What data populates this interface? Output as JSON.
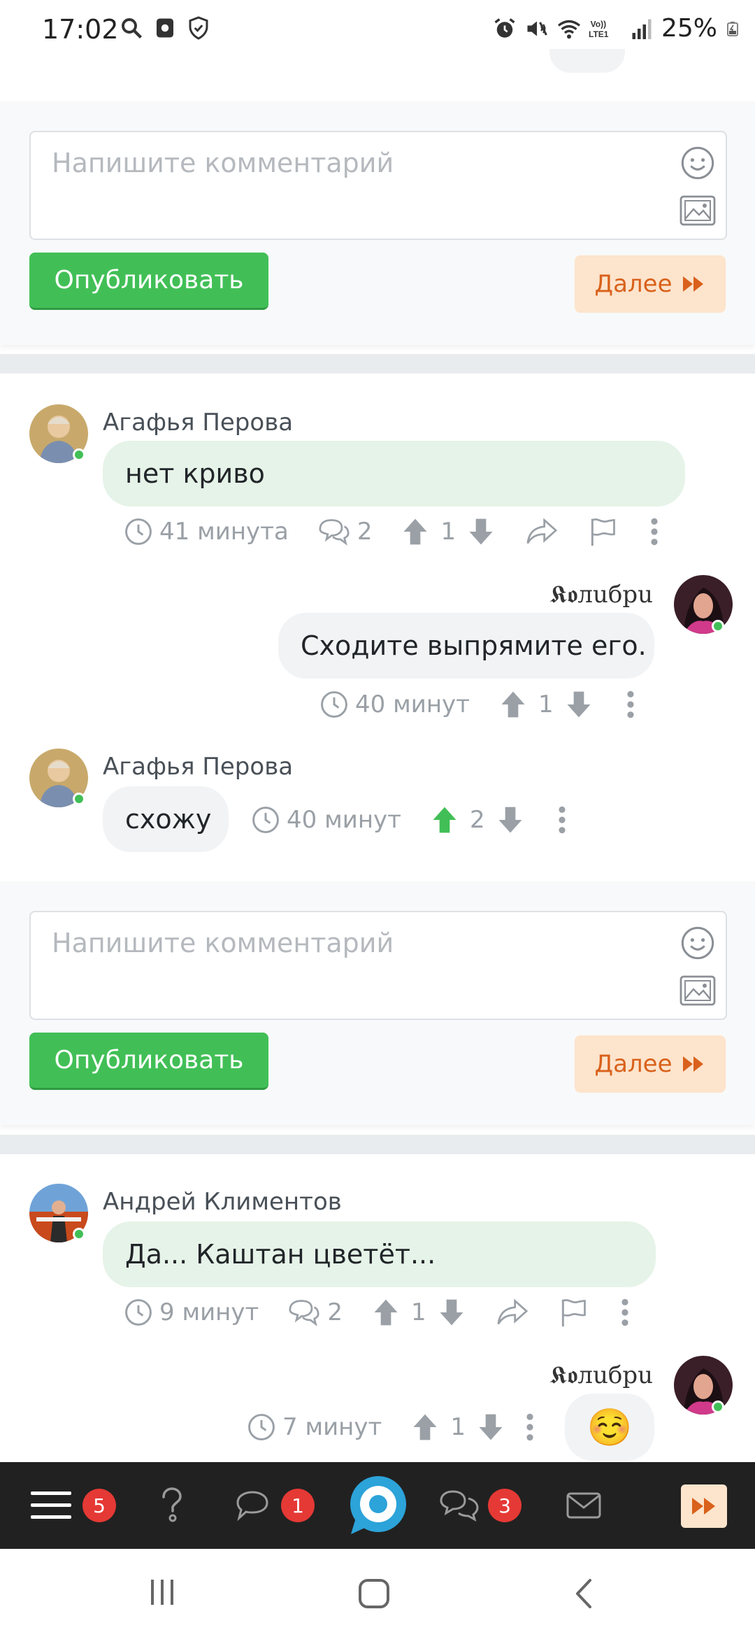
{
  "status_bar": {
    "time": "17:02",
    "battery": "25%",
    "icons_left": [
      "search-icon",
      "screen-record-icon",
      "shield-icon"
    ],
    "icons_right": [
      "alarm-icon",
      "mute-icon",
      "wifi-icon",
      "volte-icon",
      "signal-icon",
      "battery-icon"
    ]
  },
  "comment_form_1": {
    "placeholder": "Напишите комментарий",
    "publish_label": "Опубликовать",
    "next_label": "Далее"
  },
  "thread_1": {
    "comments": [
      {
        "author": "Агафья Перова",
        "text": "нет криво",
        "time": "41 минута",
        "replies": "2",
        "votes": "1"
      },
      {
        "author": "𝕶𝖔лuбpu",
        "text": "Сходите выпрямите его.",
        "time": "40 минут",
        "votes": "1"
      },
      {
        "author": "Агафья Перова",
        "text": "схожу",
        "time": "40 минут",
        "votes": "2"
      }
    ]
  },
  "comment_form_2": {
    "placeholder": "Напишите комментарий",
    "publish_label": "Опубликовать",
    "next_label": "Далее"
  },
  "thread_2": {
    "comments": [
      {
        "author": "Андрей Климентов",
        "text": "Да... Каштан цветёт...",
        "time": "9 минут",
        "replies": "2",
        "votes": "1"
      },
      {
        "author": "𝕶𝖔лuбpu",
        "text": "☺️",
        "time": "7 минут",
        "votes": "1"
      }
    ]
  },
  "bottom_nav": {
    "menu_badge": "5",
    "messages_badge": "1",
    "chats_badge": "3"
  },
  "colors": {
    "accent_green": "#41bf56",
    "next_bg": "#fde4cc",
    "next_text": "#d9611b",
    "badge_red": "#e53935",
    "nav_bg": "#212121"
  }
}
